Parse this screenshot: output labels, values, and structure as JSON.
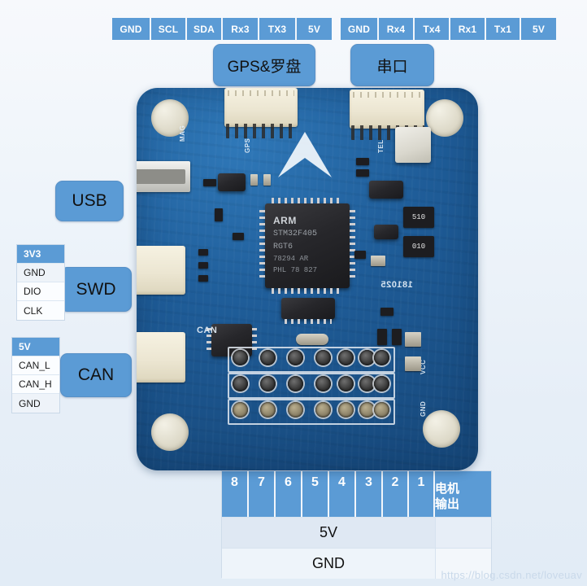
{
  "title": "Flight controller board pinout diagram",
  "top_headers": [
    {
      "group": "gps_compass",
      "pins": [
        "GND",
        "SCL",
        "SDA",
        "Rx3",
        "TX3",
        "5V"
      ],
      "callout": "GPS&罗盘"
    },
    {
      "group": "serial_port",
      "pins": [
        "GND",
        "Rx4",
        "Tx4",
        "Rx1",
        "Tx1",
        "5V"
      ],
      "callout": "串口"
    }
  ],
  "left_callouts": {
    "usb": "USB",
    "swd": "SWD",
    "can": "CAN"
  },
  "swd_pins": [
    "3V3",
    "GND",
    "DIO",
    "CLK"
  ],
  "can_pins": [
    "5V",
    "CAN_L",
    "CAN_H",
    "GND"
  ],
  "motor_table": {
    "channels": [
      "8",
      "7",
      "6",
      "5",
      "4",
      "3",
      "2",
      "1"
    ],
    "label": "电机\n输出",
    "label_line1": "电机",
    "label_line2": "输出",
    "rows": [
      "5V",
      "GND"
    ]
  },
  "watermark": "https://blog.csdn.net/loveuav",
  "board_silkscreen": {
    "mcu_line1": "ARM",
    "mcu_line2": "STM32F405",
    "mcu_line3": "RGT6",
    "mcu_line4": "78294  AR",
    "mcu_line5": "PHL 78 827",
    "can_label": "CAN",
    "mag_label": "MAG",
    "gps_label": "GPS",
    "tel_label": "TEL",
    "vcc_label": "VCC",
    "gnd_label": "GND",
    "date_code": "181025",
    "res_a": "510",
    "res_b": "010"
  },
  "colors": {
    "accent_blue": "#5b9bd5",
    "cell_text": "#ffffff",
    "background_top": "#f7f9fc",
    "background_bottom": "#e2ecf6",
    "pcb_blue": "#1f5d99",
    "watermark": "#c9d9ea"
  }
}
